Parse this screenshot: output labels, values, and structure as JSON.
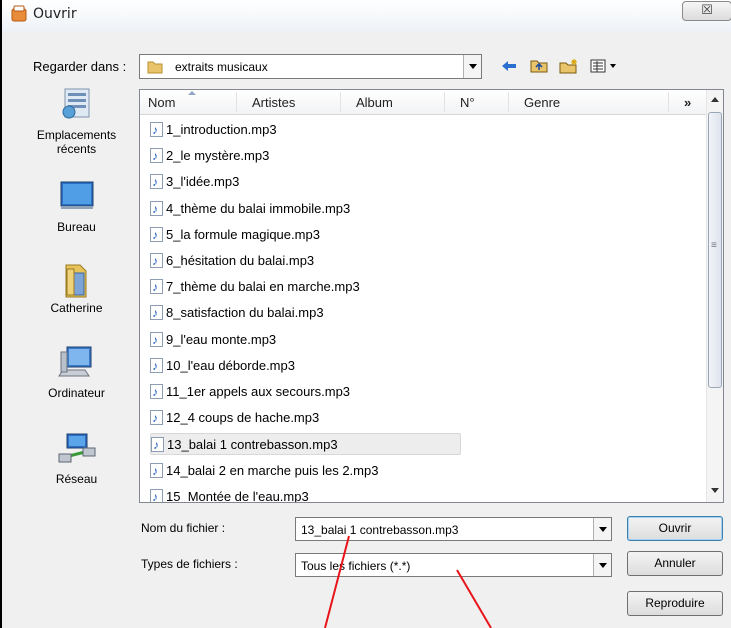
{
  "window": {
    "title": "Ouvrir",
    "close_label": "☒"
  },
  "lookin": {
    "label": "Regarder dans :",
    "value": "extraits musicaux",
    "toolbar": [
      "back-icon",
      "up-folder-icon",
      "new-folder-icon",
      "views-menu-icon"
    ]
  },
  "places": [
    {
      "label": "Emplacements récents",
      "icon": "recent-places-icon"
    },
    {
      "label": "Bureau",
      "icon": "desktop-icon"
    },
    {
      "label": "Catherine",
      "icon": "user-folder-icon"
    },
    {
      "label": "Ordinateur",
      "icon": "computer-icon"
    },
    {
      "label": "Réseau",
      "icon": "network-icon"
    }
  ],
  "columns": [
    "Nom",
    "Artistes",
    "Album",
    "N°",
    "Genre",
    "»"
  ],
  "files": [
    "1_introduction.mp3",
    "2_le mystère.mp3",
    "3_l'idée.mp3",
    "4_thème du balai immobile.mp3",
    "5_la formule magique.mp3",
    "6_hésitation du balai.mp3",
    "7_thème du balai en marche.mp3",
    "8_satisfaction du balai.mp3",
    "9_l'eau monte.mp3",
    "10_l'eau déborde.mp3",
    "11_1er appels aux secours.mp3",
    "12_4 coups de hache.mp3",
    "13_balai 1 contrebasson.mp3",
    "14_balai 2 en marche puis les 2.mp3",
    "15_Montée de l'eau.mp3"
  ],
  "selected_file": "13_balai 1 contrebasson.mp3",
  "filename": {
    "label": "Nom du fichier :",
    "value": "13_balai 1 contrebasson.mp3"
  },
  "filetype": {
    "label": "Types de fichiers :",
    "value": "Tous les fichiers (*.*)"
  },
  "buttons": {
    "open": "Ouvrir",
    "cancel": "Annuler",
    "play": "Reproduire"
  },
  "colors": {
    "annotation": "#e8141a",
    "selection": "#ededed",
    "accent": "#3c7fb1"
  }
}
